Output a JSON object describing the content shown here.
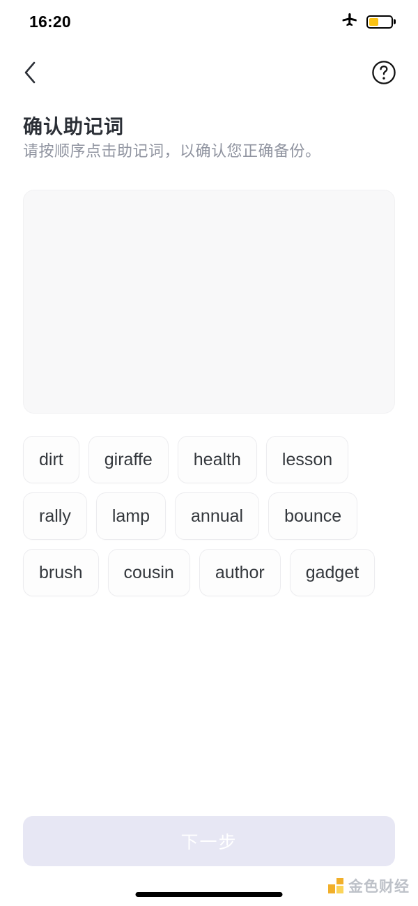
{
  "status_bar": {
    "time": "16:20",
    "airplane_icon": "airplane-icon",
    "battery_icon": "battery-icon",
    "battery_level_percent": 42,
    "battery_color": "#fac213"
  },
  "nav_bar": {
    "back_icon": "chevron-left-icon",
    "help_icon": "help-circle-icon"
  },
  "header": {
    "title": "确认助记词",
    "subtitle": "请按顺序点击助记词，以确认您正确备份。"
  },
  "drop_zone": {
    "name": "selected-words-area",
    "selected_words": []
  },
  "word_bank": {
    "words": [
      "dirt",
      "giraffe",
      "health",
      "lesson",
      "rally",
      "lamp",
      "annual",
      "bounce",
      "brush",
      "cousin",
      "author",
      "gadget"
    ]
  },
  "footer": {
    "next_label": "下一步",
    "next_disabled": true,
    "next_bg_color": "#e7e7f4"
  },
  "watermark": {
    "text": "金色财经",
    "logo_color": "#f0a919"
  }
}
